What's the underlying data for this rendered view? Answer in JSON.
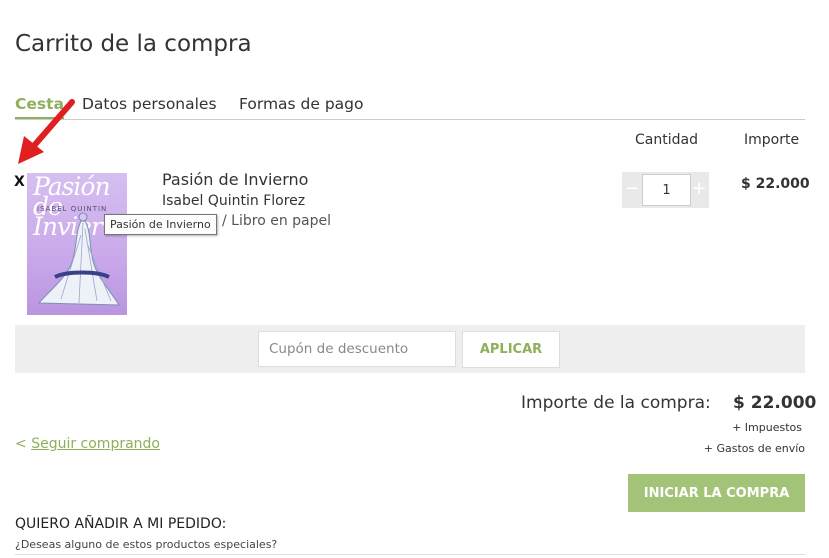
{
  "page": {
    "title": "Carrito de la compra"
  },
  "tabs": [
    {
      "label": "Cesta",
      "active": true
    },
    {
      "label": "Datos personales",
      "active": false
    },
    {
      "label": "Formas de pago",
      "active": false
    }
  ],
  "columns": {
    "quantity": "Cantidad",
    "amount": "Importe"
  },
  "item": {
    "remove_label": "X",
    "cover_title": "Pasión de Invierno",
    "cover_author": "ISABEL QUINTIN",
    "title": "Pasión de Invierno",
    "author": "Isabel Quintin Florez",
    "format": "/ Libro en papel",
    "tooltip": "Pasión de Invierno",
    "quantity": "1",
    "minus": "−",
    "plus": "+",
    "price": "$ 22.000"
  },
  "coupon": {
    "placeholder": "Cupón de descuento",
    "apply_label": "APLICAR"
  },
  "totals": {
    "label": "Importe de la compra:",
    "value": "$ 22.000",
    "taxes": "+ Impuestos",
    "shipping": "+ Gastos de envío"
  },
  "continue": {
    "prefix": "<",
    "label": "Seguir comprando"
  },
  "checkout": {
    "label": "INICIAR LA COMPRA"
  },
  "addons": {
    "title": "QUIERO AÑADIR A MI PEDIDO:",
    "subtitle": "¿Deseas alguno de estos productos especiales?"
  },
  "colors": {
    "accent": "#8fb05a",
    "checkout_bg": "#a3c478",
    "annotation_arrow": "#e02020"
  },
  "icons": {
    "annotation": "red-arrow-icon"
  }
}
